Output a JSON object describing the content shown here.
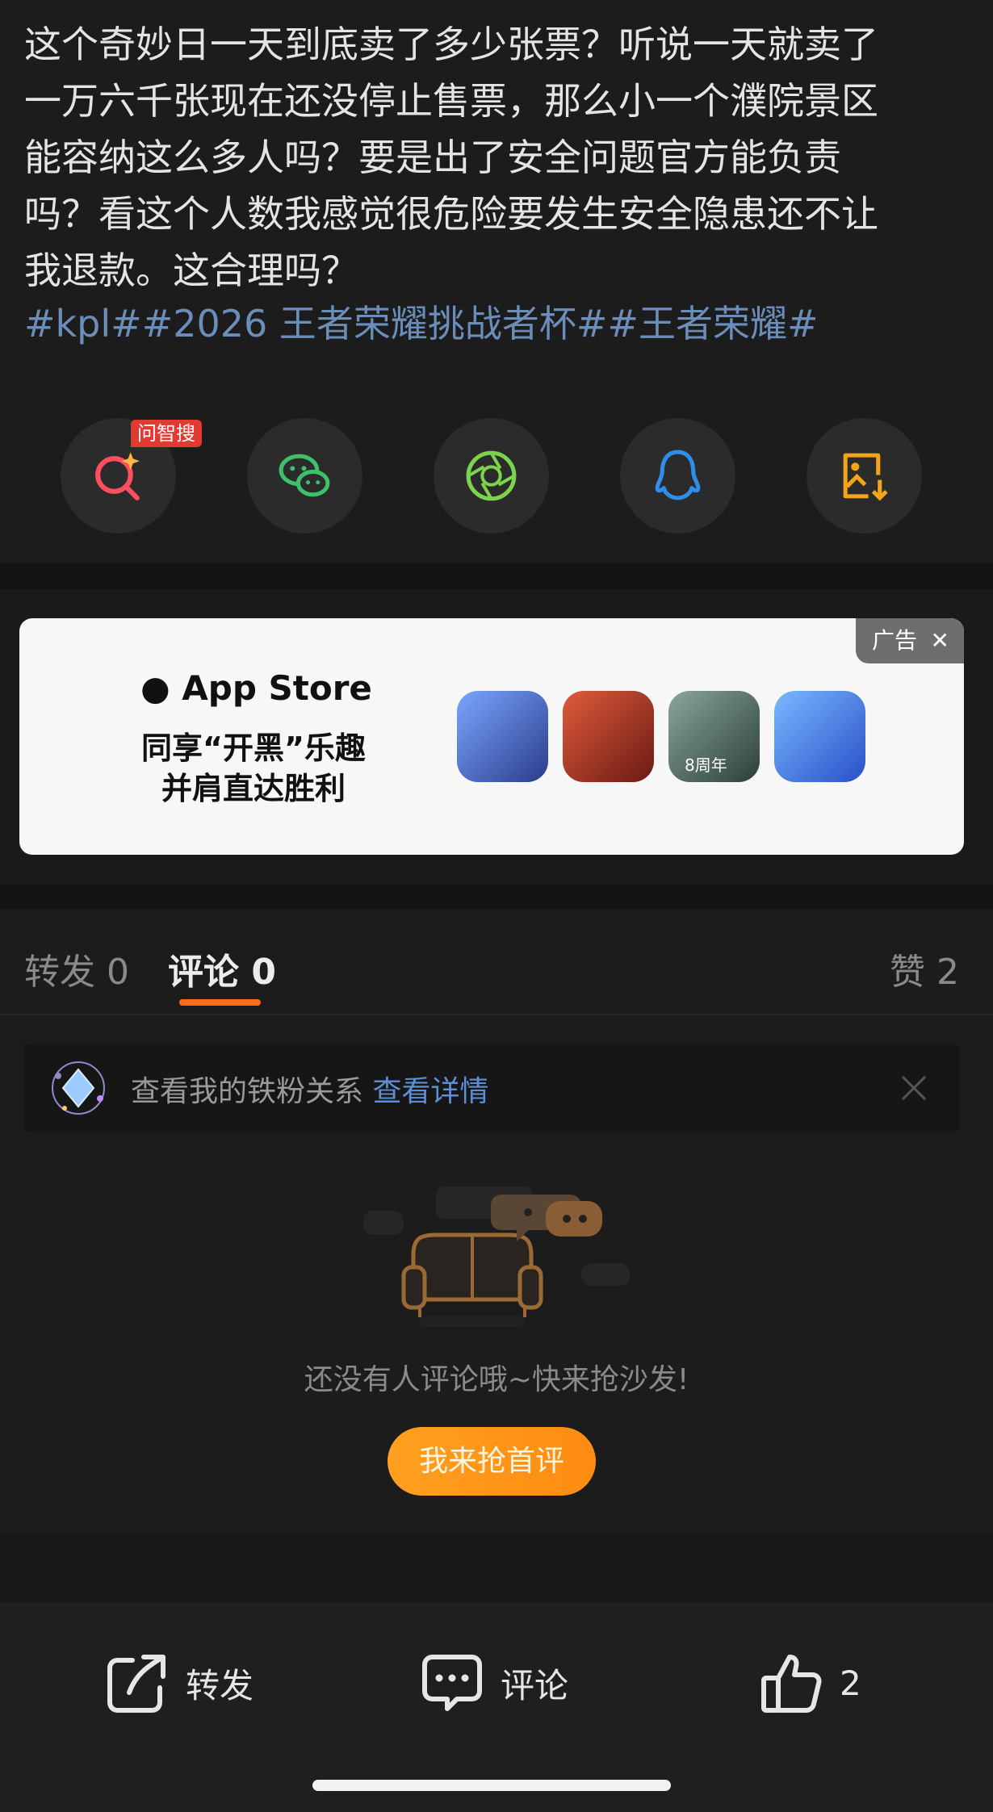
{
  "post": {
    "text_lines": [
      "这个奇妙日一天到底卖了多少张票？听说一天就卖了",
      "一万六千张现在还没停止售票，那么小一个濮院景区",
      "能容纳这么多人吗？要是出了安全问题官方能负责",
      "吗？看这个人数我感觉很危险要发生安全隐患还不让",
      "我退款。这合理吗？"
    ],
    "hashtags": "#kpl##2026 王者荣耀挑战者杯##王者荣耀#"
  },
  "share": {
    "badge": "问智搜",
    "items": [
      {
        "name": "ask-search-icon",
        "color": "#ff4f5e"
      },
      {
        "name": "wechat-icon",
        "color": "#3cc06a"
      },
      {
        "name": "moments-icon",
        "color": "#7cd34c"
      },
      {
        "name": "qq-icon",
        "color": "#2f8fe6"
      },
      {
        "name": "save-image-icon",
        "color": "#f2a51a"
      }
    ]
  },
  "ad": {
    "tag": "广告",
    "close": "✕",
    "brand": "App Store",
    "line1": "同享“开黑”乐趣",
    "line2": "并肩直达胜利",
    "apps": [
      {
        "name": "app-icon-1",
        "color": "#5a7ad8"
      },
      {
        "name": "app-icon-2",
        "color": "#c43a2c"
      },
      {
        "name": "app-icon-3",
        "color": "#4e7166",
        "badge": "8周年"
      },
      {
        "name": "app-icon-4",
        "color": "#3b67d0"
      }
    ]
  },
  "tabs": {
    "repost": "转发 0",
    "comment": "评论 0",
    "like": "赞 2"
  },
  "fan": {
    "text": "查看我的铁粉关系",
    "link": "查看详情"
  },
  "empty": {
    "message": "还没有人评论哦~快来抢沙发!",
    "cta": "我来抢首评"
  },
  "footer": {
    "repost": "转发",
    "comment": "评论",
    "likes": "2"
  },
  "colors": {
    "accent": "#ff6b1a",
    "link": "#5d8fd6",
    "hashtag": "#6b8db9"
  }
}
